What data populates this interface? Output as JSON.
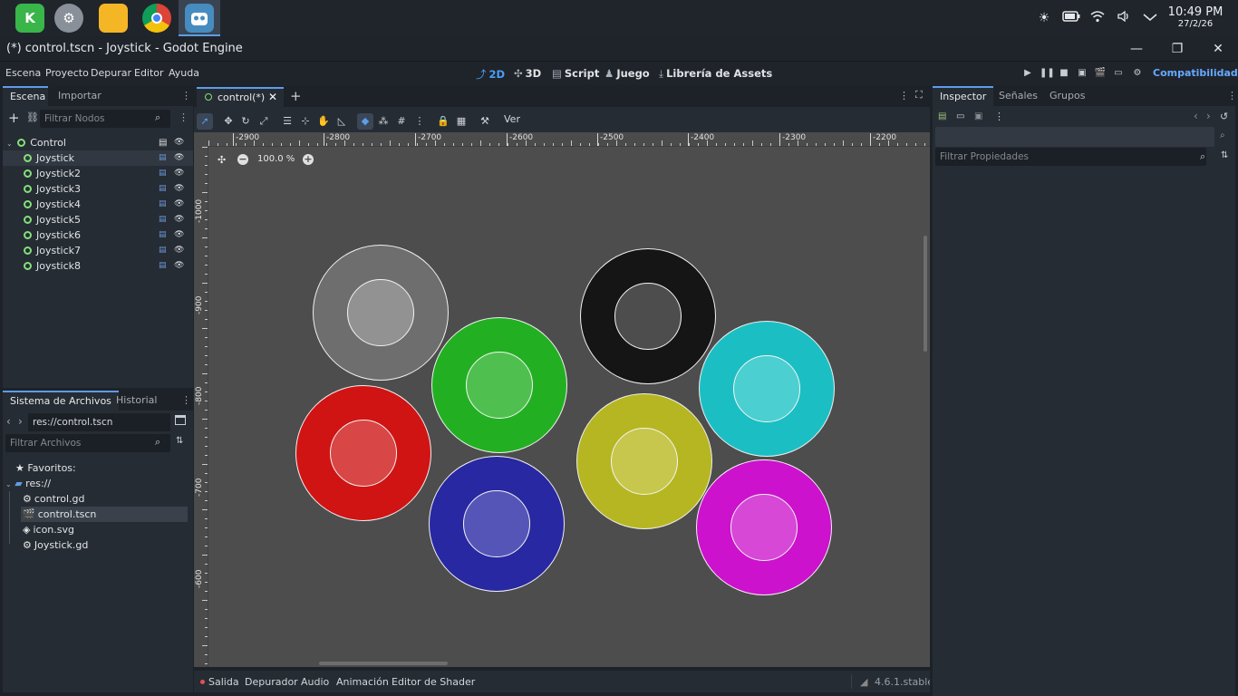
{
  "taskbar": {
    "apps": [
      {
        "name": "kde-icon",
        "label": "K"
      },
      {
        "name": "settings-app-icon",
        "label": "⚙"
      },
      {
        "name": "files-app-icon",
        "label": ""
      },
      {
        "name": "chrome-app-icon",
        "label": ""
      },
      {
        "name": "godot-app-icon",
        "label": ""
      }
    ],
    "clock_time": "10:49 PM",
    "clock_date": "27/2/26"
  },
  "window": {
    "title": "(*) control.tscn - Joystick - Godot Engine"
  },
  "menubar": {
    "menus": [
      "Escena",
      "Proyecto",
      "Depurar",
      "Editor",
      "Ayuda"
    ],
    "workspaces": [
      "2D",
      "3D",
      "Script",
      "Juego",
      "Librería de Assets"
    ],
    "active_workspace": "2D",
    "renderer": "Compatibilidad"
  },
  "scene_dock": {
    "tabs": [
      "Escena",
      "Importar"
    ],
    "filter_placeholder": "Filtrar Nodos",
    "root": "Control",
    "nodes": [
      "Joystick",
      "Joystick2",
      "Joystick3",
      "Joystick4",
      "Joystick5",
      "Joystick6",
      "Joystick7",
      "Joystick8"
    ]
  },
  "filesystem_dock": {
    "tabs": [
      "Sistema de Archivos",
      "Historial"
    ],
    "path": "res://control.tscn",
    "filter_placeholder": "Filtrar Archivos",
    "favorites_label": "Favoritos:",
    "root_label": "res://",
    "files": [
      "control.gd",
      "control.tscn",
      "icon.svg",
      "Joystick.gd"
    ],
    "selected_file": "control.tscn"
  },
  "editor": {
    "scene_tab": "control(*)",
    "view_menu": "Ver",
    "zoom": "100.0 %",
    "ruler_x_labels": [
      "-2900",
      "-2800",
      "-2700",
      "-2600",
      "-2500",
      "-2400",
      "-2300",
      "-2200"
    ],
    "ruler_y_labels": [
      "-1000",
      "-900",
      "-800",
      "-700",
      "-600"
    ]
  },
  "canvas": {
    "joysticks": [
      {
        "outer": "#6e6e6e",
        "inner": "#929292"
      },
      {
        "outer": "#22b022",
        "inner": "#4fc04f"
      },
      {
        "outer": "#151515",
        "inner": "#4d4d4d"
      },
      {
        "outer": "#1bbfc3",
        "inner": "#4ccfd0"
      },
      {
        "outer": "#d01414",
        "inner": "#d84646"
      },
      {
        "outer": "#b6b622",
        "inner": "#c7c74d"
      },
      {
        "outer": "#2828a2",
        "inner": "#5555b8"
      },
      {
        "outer": "#cc12cc",
        "inner": "#d748d7"
      }
    ]
  },
  "inspector": {
    "tabs": [
      "Inspector",
      "Señales",
      "Grupos"
    ],
    "filter_placeholder": "Filtrar Propiedades"
  },
  "bottom_panel": {
    "tabs": [
      "Salida",
      "Depurador",
      "Audio",
      "Animación",
      "Editor de Shader"
    ],
    "version": "4.6.1.stable"
  }
}
